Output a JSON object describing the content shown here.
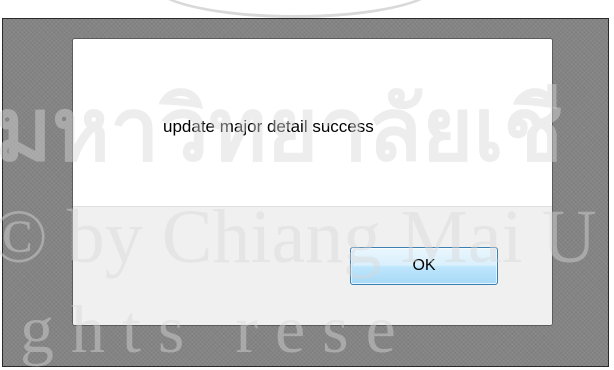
{
  "dialog": {
    "message": "update major detail success",
    "ok_label": "OK"
  },
  "watermark": {
    "line1": "มหาวิทยาลัยเชี",
    "line2": "© by Chiang Mai U",
    "line3": "g h t s   r e s e"
  },
  "colors": {
    "backdrop": "#848484",
    "dialog_body": "#ffffff",
    "dialog_footer": "#f0f0f0",
    "button_border": "#3c7fb1",
    "watermark": "#d9d9d9"
  }
}
